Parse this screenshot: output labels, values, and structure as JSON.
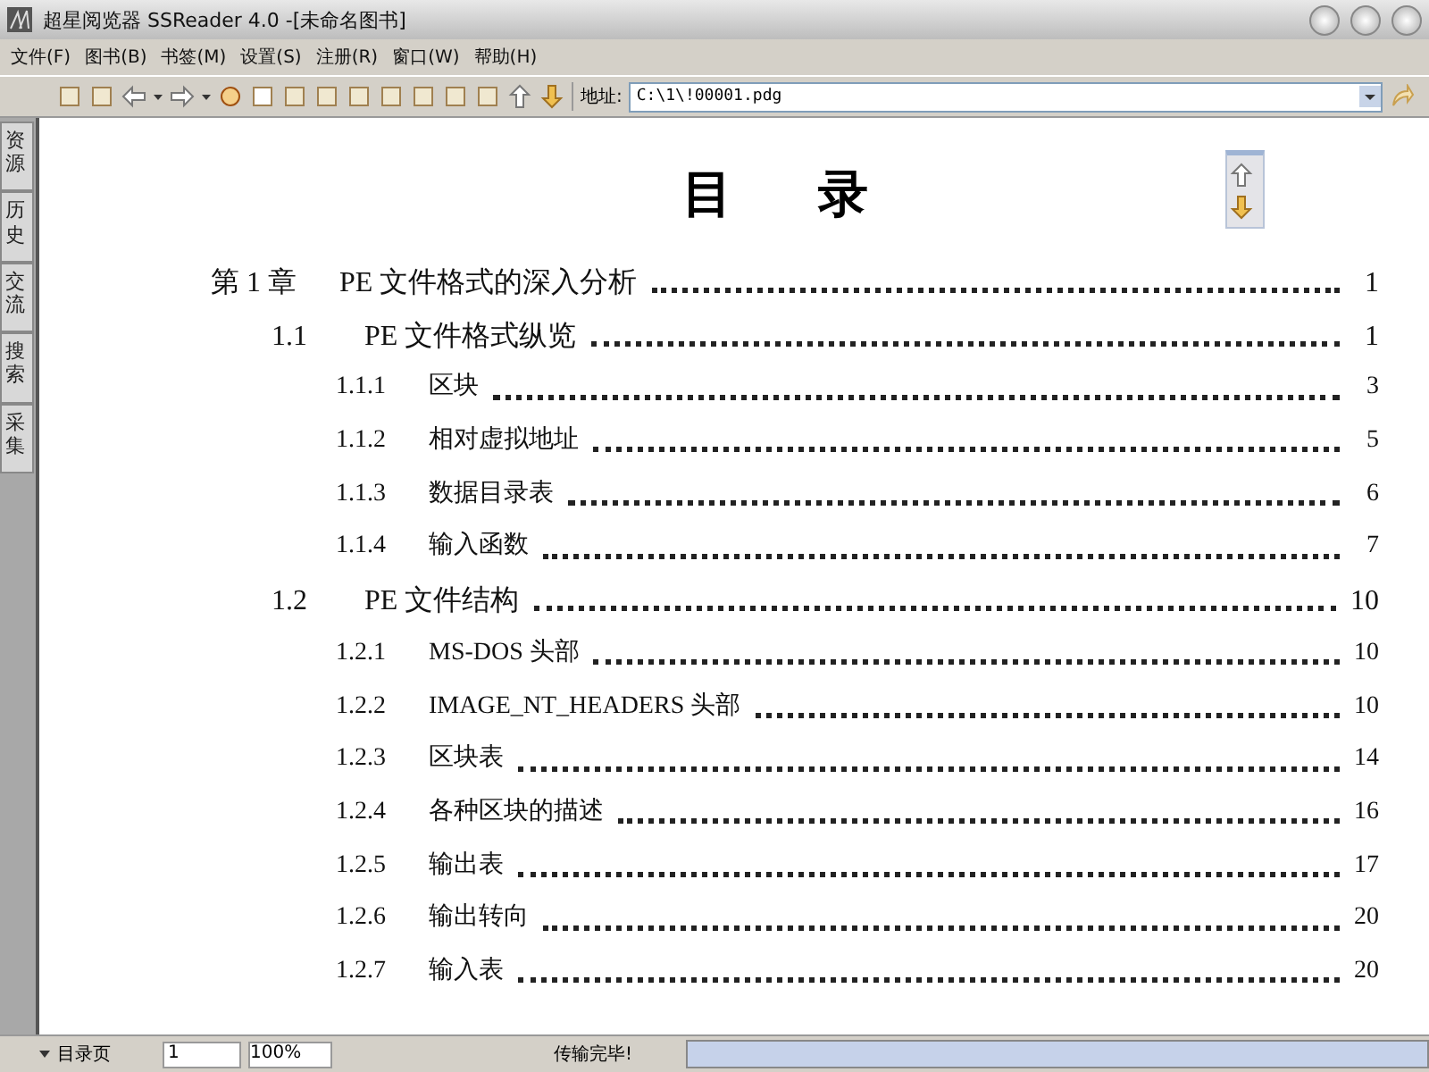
{
  "window": {
    "title": "超星阅览器 SSReader 4.0 -[未命名图书]"
  },
  "menu": [
    "文件(F)",
    "图书(B)",
    "书签(M)",
    "设置(S)",
    "注册(R)",
    "窗口(W)",
    "帮助(H)"
  ],
  "address": {
    "label": "地址:",
    "value": "C:\\1\\!00001.pdg"
  },
  "side_tabs": [
    "资源",
    "历史",
    "交流",
    "搜索",
    "采集"
  ],
  "page": {
    "heading": "目录",
    "toc": [
      {
        "number": "第 1 章",
        "title": "PE 文件格式的深入分析",
        "page": "1",
        "children": [
          {
            "number": "1.1",
            "title": "PE 文件格式纵览",
            "page": "1",
            "children": [
              {
                "number": "1.1.1",
                "title": "区块",
                "page": "3"
              },
              {
                "number": "1.1.2",
                "title": "相对虚拟地址",
                "page": "5"
              },
              {
                "number": "1.1.3",
                "title": "数据目录表",
                "page": "6"
              },
              {
                "number": "1.1.4",
                "title": "输入函数",
                "page": "7"
              }
            ]
          },
          {
            "number": "1.2",
            "title": "PE 文件结构",
            "page": "10",
            "children": [
              {
                "number": "1.2.1",
                "title": "MS-DOS 头部",
                "page": "10"
              },
              {
                "number": "1.2.2",
                "title": "IMAGE_NT_HEADERS 头部",
                "page": "10"
              },
              {
                "number": "1.2.3",
                "title": "区块表",
                "page": "14"
              },
              {
                "number": "1.2.4",
                "title": "各种区块的描述",
                "page": "16"
              },
              {
                "number": "1.2.5",
                "title": "输出表",
                "page": "17"
              },
              {
                "number": "1.2.6",
                "title": "输出转向",
                "page": "20"
              },
              {
                "number": "1.2.7",
                "title": "输入表",
                "page": "20"
              }
            ]
          }
        ]
      }
    ]
  },
  "status_bar": {
    "view": "目录页",
    "page_number": "1",
    "zoom": "100%",
    "message": "传输完毕!"
  }
}
